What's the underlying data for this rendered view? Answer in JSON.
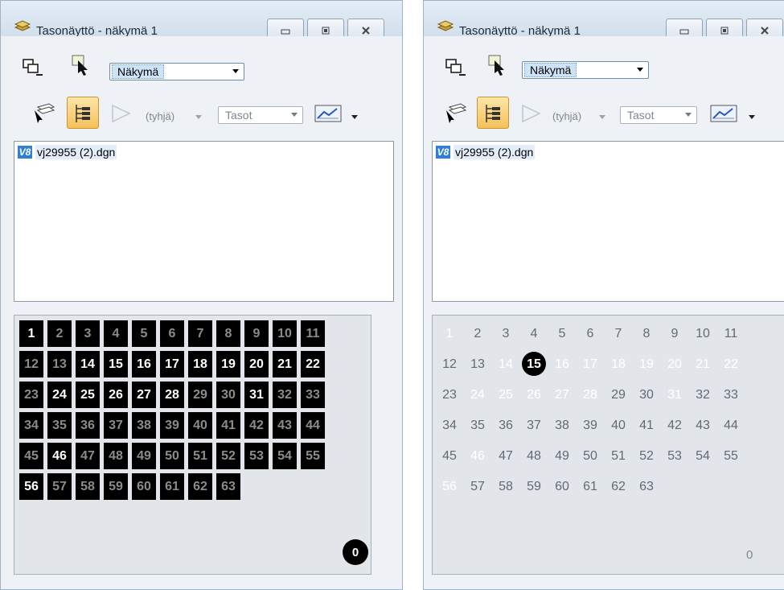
{
  "windows": [
    {
      "title": "Tasonäyttö - näkymä 1",
      "view_select": "Näkymä",
      "filter_label": "(tyhjä)",
      "levels_select": "Tasot",
      "file": {
        "badge": "V8",
        "name": "vj29955 (2).dgn"
      },
      "grid_style": "dark",
      "levels": [
        "1",
        "2",
        "3",
        "4",
        "5",
        "6",
        "7",
        "8",
        "9",
        "10",
        "11",
        "12",
        "13",
        "14",
        "15",
        "16",
        "17",
        "18",
        "19",
        "20",
        "21",
        "22",
        "23",
        "24",
        "25",
        "26",
        "27",
        "28",
        "29",
        "30",
        "31",
        "32",
        "33",
        "34",
        "35",
        "36",
        "37",
        "38",
        "39",
        "40",
        "41",
        "42",
        "43",
        "44",
        "45",
        "46",
        "47",
        "48",
        "49",
        "50",
        "51",
        "52",
        "53",
        "54",
        "55",
        "56",
        "57",
        "58",
        "59",
        "60",
        "61",
        "62",
        "63"
      ],
      "highlighted": [
        "1",
        "14",
        "15",
        "16",
        "17",
        "18",
        "19",
        "20",
        "21",
        "22",
        "24",
        "25",
        "26",
        "27",
        "28",
        "31",
        "46",
        "56"
      ],
      "active": [],
      "default_level": "0"
    },
    {
      "title": "Tasonäyttö - näkymä 1",
      "view_select": "Näkymä",
      "filter_label": "(tyhjä)",
      "levels_select": "Tasot",
      "file": {
        "badge": "V8",
        "name": "vj29955 (2).dgn"
      },
      "grid_style": "light",
      "levels": [
        "1",
        "2",
        "3",
        "4",
        "5",
        "6",
        "7",
        "8",
        "9",
        "10",
        "11",
        "12",
        "13",
        "14",
        "15",
        "16",
        "17",
        "18",
        "19",
        "20",
        "21",
        "22",
        "23",
        "24",
        "25",
        "26",
        "27",
        "28",
        "29",
        "30",
        "31",
        "32",
        "33",
        "34",
        "35",
        "36",
        "37",
        "38",
        "39",
        "40",
        "41",
        "42",
        "43",
        "44",
        "45",
        "46",
        "47",
        "48",
        "49",
        "50",
        "51",
        "52",
        "53",
        "54",
        "55",
        "56",
        "57",
        "58",
        "59",
        "60",
        "61",
        "62",
        "63"
      ],
      "highlighted": [
        "1",
        "14",
        "16",
        "17",
        "18",
        "19",
        "20",
        "21",
        "22",
        "24",
        "25",
        "26",
        "27",
        "28",
        "31",
        "46",
        "56"
      ],
      "active": [
        "15"
      ],
      "default_level": "0"
    }
  ]
}
